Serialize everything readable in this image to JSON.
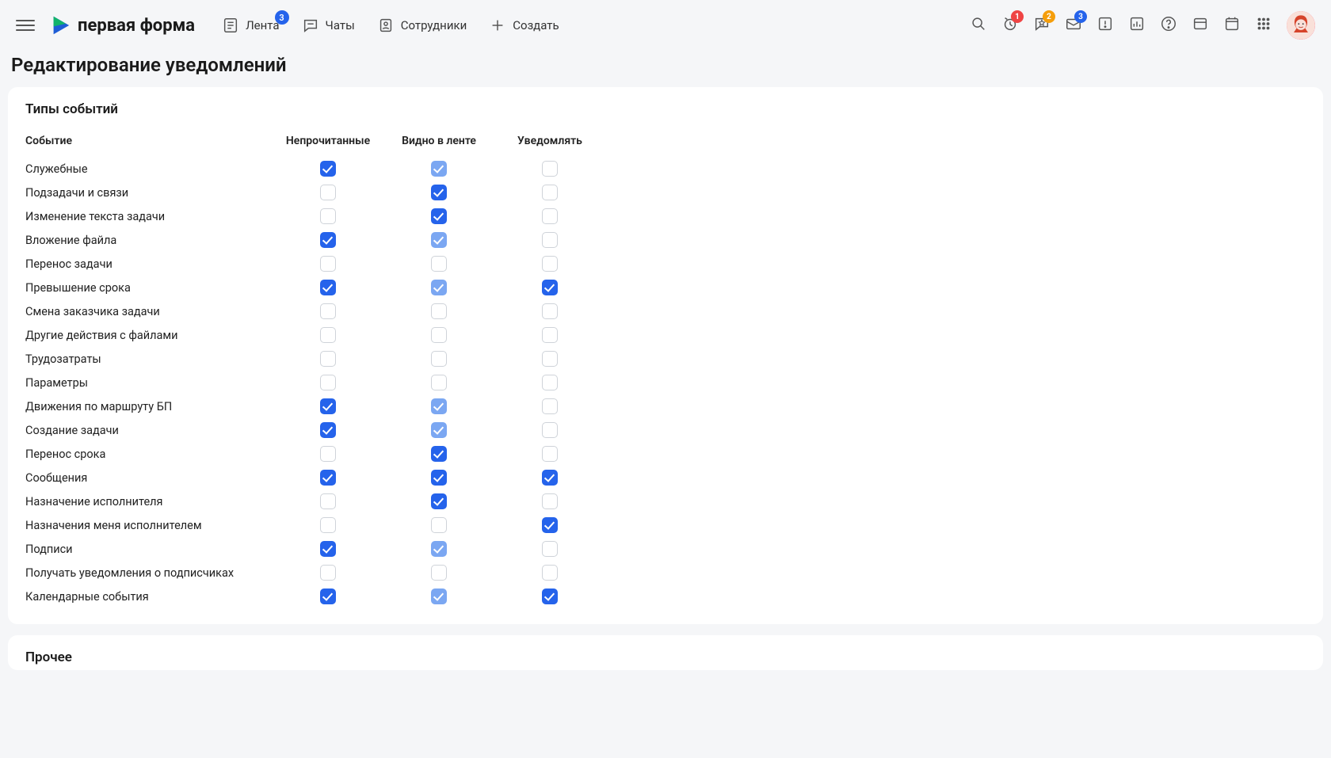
{
  "header": {
    "brand": "первая форма",
    "nav": [
      {
        "key": "feed",
        "label": "Лента",
        "badge": "3"
      },
      {
        "key": "chats",
        "label": "Чаты",
        "badge": null
      },
      {
        "key": "employees",
        "label": "Сотрудники",
        "badge": null
      },
      {
        "key": "create",
        "label": "Создать",
        "badge": null
      }
    ],
    "icon_badges": {
      "clock": "1",
      "star": "2",
      "mail": "3"
    }
  },
  "page": {
    "title": "Редактирование уведомлений"
  },
  "eventTypes": {
    "title": "Типы событий",
    "columns": {
      "event": "Событие",
      "unread": "Непрочитанные",
      "visible": "Видно в ленте",
      "notify": "Уведомлять"
    },
    "rows": [
      {
        "label": "Служебные",
        "unread": "checked",
        "visible": "light",
        "notify": "off"
      },
      {
        "label": "Подзадачи и связи",
        "unread": "off",
        "visible": "checked",
        "notify": "off"
      },
      {
        "label": "Изменение текста задачи",
        "unread": "off",
        "visible": "checked",
        "notify": "off"
      },
      {
        "label": "Вложение файла",
        "unread": "checked",
        "visible": "light",
        "notify": "off"
      },
      {
        "label": "Перенос задачи",
        "unread": "off",
        "visible": "off",
        "notify": "off"
      },
      {
        "label": "Превышение срока",
        "unread": "checked",
        "visible": "light",
        "notify": "checked"
      },
      {
        "label": "Смена заказчика задачи",
        "unread": "off",
        "visible": "off",
        "notify": "off"
      },
      {
        "label": "Другие действия с файлами",
        "unread": "off",
        "visible": "off",
        "notify": "off"
      },
      {
        "label": "Трудозатраты",
        "unread": "off",
        "visible": "off",
        "notify": "off"
      },
      {
        "label": "Параметры",
        "unread": "off",
        "visible": "off",
        "notify": "off"
      },
      {
        "label": "Движения по маршруту БП",
        "unread": "checked",
        "visible": "light",
        "notify": "off"
      },
      {
        "label": "Создание задачи",
        "unread": "checked",
        "visible": "light",
        "notify": "off"
      },
      {
        "label": "Перенос срока",
        "unread": "off",
        "visible": "checked",
        "notify": "off"
      },
      {
        "label": "Сообщения",
        "unread": "checked",
        "visible": "checked",
        "notify": "checked"
      },
      {
        "label": "Назначение исполнителя",
        "unread": "off",
        "visible": "checked",
        "notify": "off"
      },
      {
        "label": "Назначения меня исполнителем",
        "unread": "off",
        "visible": "off",
        "notify": "checked"
      },
      {
        "label": "Подписи",
        "unread": "checked",
        "visible": "light",
        "notify": "off"
      },
      {
        "label": "Получать уведомления о подписчиках",
        "unread": "off",
        "visible": "off",
        "notify": "off"
      },
      {
        "label": "Календарные события",
        "unread": "checked",
        "visible": "light",
        "notify": "checked"
      }
    ]
  },
  "other": {
    "title": "Прочее"
  }
}
